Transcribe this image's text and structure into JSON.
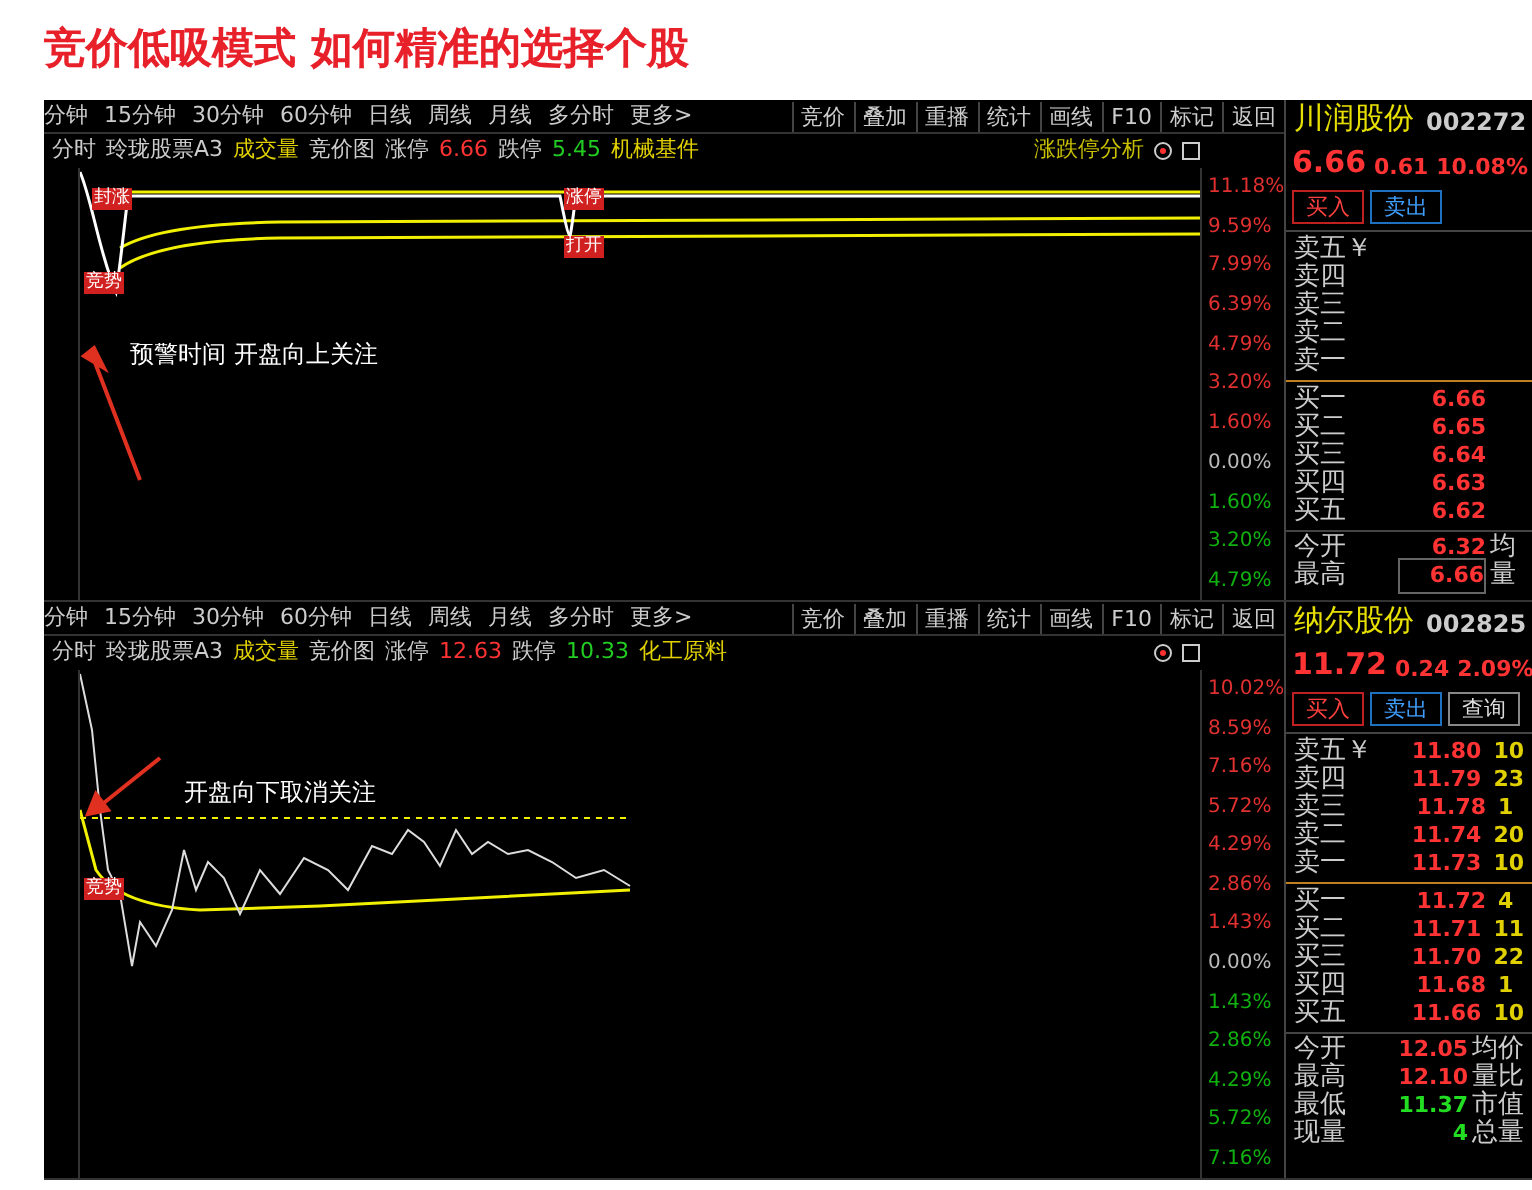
{
  "title": "竞价低吸模式 如何精准的选择个股",
  "panels": [
    {
      "periods": [
        "分钟",
        "15分钟",
        "30分钟",
        "60分钟",
        "日线",
        "周线",
        "月线",
        "多分时",
        "更多>"
      ],
      "tools": [
        "竞价",
        "叠加",
        "重播",
        "统计",
        "画线",
        "F10",
        "标记",
        "返回"
      ],
      "info": {
        "mode": "分时",
        "indicator": "玲珑股票A3",
        "volume": "成交量",
        "auction": "竞价图",
        "up_label": "涨停",
        "up": "6.66",
        "down_label": "跌停",
        "down": "5.45",
        "sector": "机械基件"
      },
      "analysis": "涨跌停分析",
      "axis": [
        {
          "label": "11.18%",
          "kind": "up"
        },
        {
          "label": "9.59%",
          "kind": "up"
        },
        {
          "label": "7.99%",
          "kind": "up"
        },
        {
          "label": "6.39%",
          "kind": "up"
        },
        {
          "label": "4.79%",
          "kind": "up"
        },
        {
          "label": "3.20%",
          "kind": "up"
        },
        {
          "label": "1.60%",
          "kind": "up"
        },
        {
          "label": "0.00%",
          "kind": "flat"
        },
        {
          "label": "1.60%",
          "kind": "down"
        },
        {
          "label": "3.20%",
          "kind": "down"
        },
        {
          "label": "4.79%",
          "kind": "down"
        }
      ],
      "markers": [
        {
          "text": "封涨",
          "kind": "red"
        },
        {
          "text": "涨停",
          "kind": "red"
        },
        {
          "text": "打开",
          "kind": "red"
        },
        {
          "text": "竞势",
          "kind": "red"
        }
      ],
      "annotation": "预警时间  开盘向上关注",
      "quote": {
        "name": "川润股份",
        "code": "002272",
        "price": "6.66",
        "change": "0.61",
        "pct": "10.08%",
        "buttons": [
          {
            "label": "买入",
            "kind": "buy"
          },
          {
            "label": "卖出",
            "kind": "sell"
          }
        ],
        "asks": [
          {
            "label": "卖五￥"
          },
          {
            "label": "卖四"
          },
          {
            "label": "卖三"
          },
          {
            "label": "卖二"
          },
          {
            "label": "卖一"
          }
        ],
        "bids": [
          {
            "label": "买一",
            "price": "6.66"
          },
          {
            "label": "买二",
            "price": "6.65"
          },
          {
            "label": "买三",
            "price": "6.64"
          },
          {
            "label": "买四",
            "price": "6.63"
          },
          {
            "label": "买五",
            "price": "6.62"
          }
        ],
        "stats": [
          {
            "label": "今开",
            "value": "6.32",
            "kind": "up",
            "extra": "均",
            "boxed": false
          },
          {
            "label": "最高",
            "value": "6.66",
            "kind": "up",
            "extra": "量",
            "boxed": true
          }
        ]
      }
    },
    {
      "periods": [
        "分钟",
        "15分钟",
        "30分钟",
        "60分钟",
        "日线",
        "周线",
        "月线",
        "多分时",
        "更多>"
      ],
      "tools": [
        "竞价",
        "叠加",
        "重播",
        "统计",
        "画线",
        "F10",
        "标记",
        "返回"
      ],
      "info": {
        "mode": "分时",
        "indicator": "玲珑股票A3",
        "volume": "成交量",
        "auction": "竞价图",
        "up_label": "涨停",
        "up": "12.63",
        "down_label": "跌停",
        "down": "10.33",
        "sector": "化工原料"
      },
      "axis": [
        {
          "label": "10.02%",
          "kind": "up"
        },
        {
          "label": "8.59%",
          "kind": "up"
        },
        {
          "label": "7.16%",
          "kind": "up"
        },
        {
          "label": "5.72%",
          "kind": "up"
        },
        {
          "label": "4.29%",
          "kind": "up"
        },
        {
          "label": "2.86%",
          "kind": "up"
        },
        {
          "label": "1.43%",
          "kind": "up"
        },
        {
          "label": "0.00%",
          "kind": "flat"
        },
        {
          "label": "1.43%",
          "kind": "down"
        },
        {
          "label": "2.86%",
          "kind": "down"
        },
        {
          "label": "4.29%",
          "kind": "down"
        },
        {
          "label": "5.72%",
          "kind": "down"
        },
        {
          "label": "7.16%",
          "kind": "down"
        }
      ],
      "markers": [
        {
          "text": "竞势",
          "kind": "red"
        }
      ],
      "annotation": "开盘向下取消关注",
      "quote": {
        "name": "纳尔股份",
        "code": "002825",
        "price": "11.72",
        "change": "0.24",
        "pct": "2.09%",
        "buttons": [
          {
            "label": "买入",
            "kind": "buy"
          },
          {
            "label": "卖出",
            "kind": "sell"
          },
          {
            "label": "查询",
            "kind": "other"
          }
        ],
        "asks": [
          {
            "label": "卖五￥",
            "price": "11.80",
            "vol": "10"
          },
          {
            "label": "卖四",
            "price": "11.79",
            "vol": "23"
          },
          {
            "label": "卖三",
            "price": "11.78",
            "vol": "1"
          },
          {
            "label": "卖二",
            "price": "11.74",
            "vol": "20"
          },
          {
            "label": "卖一",
            "price": "11.73",
            "vol": "10"
          }
        ],
        "bids": [
          {
            "label": "买一",
            "price": "11.72",
            "vol": "4"
          },
          {
            "label": "买二",
            "price": "11.71",
            "vol": "11"
          },
          {
            "label": "买三",
            "price": "11.70",
            "vol": "22"
          },
          {
            "label": "买四",
            "price": "11.68",
            "vol": "1"
          },
          {
            "label": "买五",
            "price": "11.66",
            "vol": "10"
          }
        ],
        "stats": [
          {
            "label": "今开",
            "value": "12.05",
            "kind": "up",
            "extra": "均价",
            "boxed": false
          },
          {
            "label": "最高",
            "value": "12.10",
            "kind": "up",
            "extra": "量比",
            "boxed": false
          },
          {
            "label": "最低",
            "value": "11.37",
            "kind": "down",
            "extra": "市值",
            "boxed": false
          },
          {
            "label": "现量",
            "value": "4",
            "kind": "down",
            "extra": "总量",
            "boxed": false
          }
        ]
      }
    }
  ]
}
